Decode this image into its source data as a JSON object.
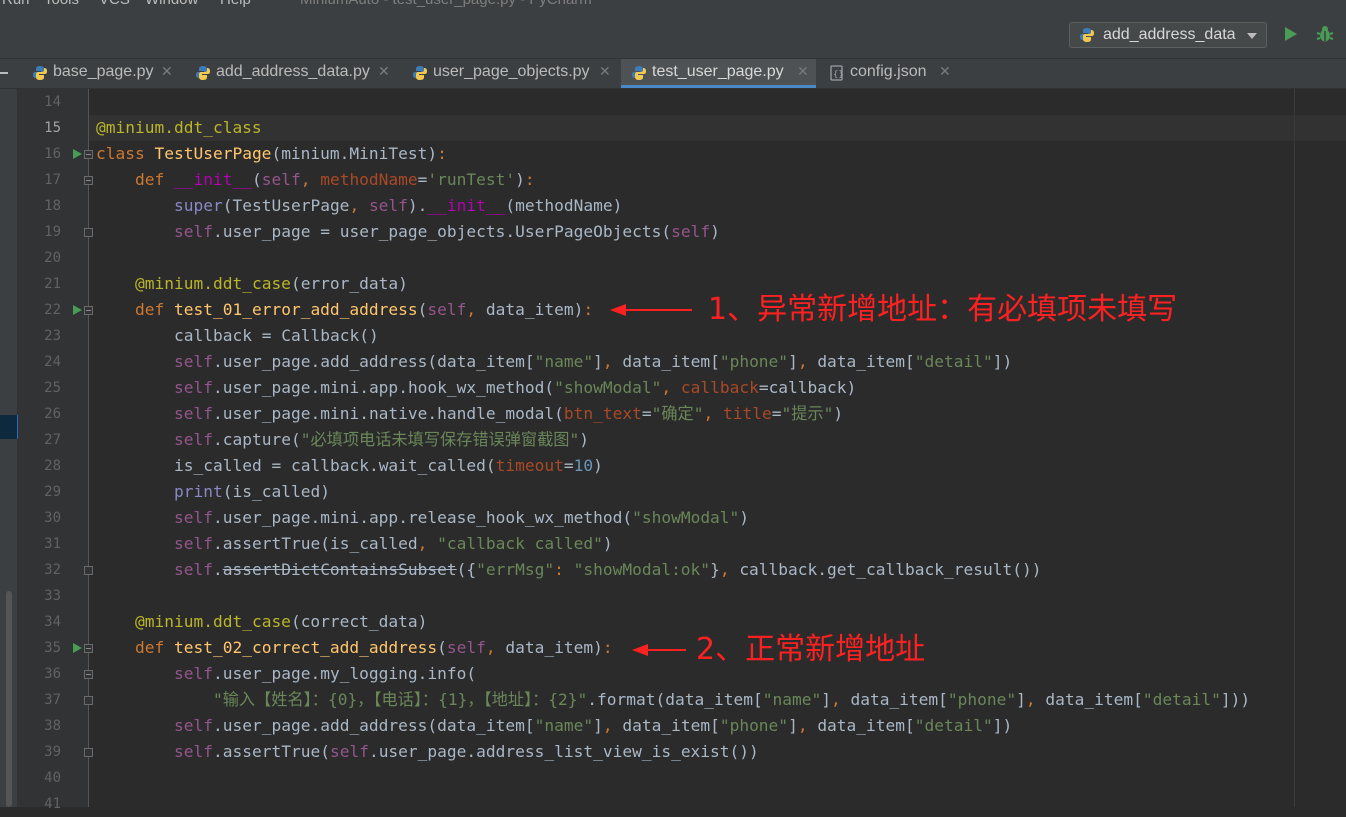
{
  "menubar": {
    "items": [
      "Run",
      "Tools",
      "VCS",
      "Window",
      "Help"
    ],
    "window_title": "MiniumAuto - test_user_page.py - PyCharm"
  },
  "toolbar": {
    "run_config_label": "add_address_data",
    "run_icon": "run-icon",
    "debug_icon": "debug-bug-icon"
  },
  "tabs": [
    {
      "label": "base_page.py",
      "icon": "python-file-icon",
      "active": false
    },
    {
      "label": "add_address_data.py",
      "icon": "python-file-icon",
      "active": false
    },
    {
      "label": "user_page_objects.py",
      "icon": "python-file-icon",
      "active": false
    },
    {
      "label": "test_user_page.py",
      "icon": "python-file-icon",
      "active": true
    },
    {
      "label": "config.json",
      "icon": "json-file-icon",
      "active": false
    }
  ],
  "editor": {
    "current_line": 15,
    "line_numbers": [
      "14",
      "15",
      "16",
      "17",
      "18",
      "19",
      "20",
      "21",
      "22",
      "23",
      "24",
      "25",
      "26",
      "27",
      "28",
      "29",
      "30",
      "31",
      "32",
      "33",
      "34",
      "35",
      "36",
      "37",
      "38",
      "39",
      "40",
      "41"
    ],
    "run_marker_lines": [
      16,
      22,
      35
    ],
    "code": [
      "",
      "@minium.ddt_class",
      "class TestUserPage(minium.MiniTest):",
      "    def __init__(self, methodName='runTest'):",
      "        super(TestUserPage, self).__init__(methodName)",
      "        self.user_page = user_page_objects.UserPageObjects(self)",
      "",
      "    @minium.ddt_case(error_data)",
      "    def test_01_error_add_address(self, data_item):",
      "        callback = Callback()",
      "        self.user_page.add_address(data_item[\"name\"], data_item[\"phone\"], data_item[\"detail\"])",
      "        self.user_page.mini.app.hook_wx_method(\"showModal\", callback=callback)",
      "        self.user_page.mini.native.handle_modal(btn_text=\"确定\", title=\"提示\")",
      "        self.capture(\"必填项电话未填写保存错误弹窗截图\")",
      "        is_called = callback.wait_called(timeout=10)",
      "        print(is_called)",
      "        self.user_page.mini.app.release_hook_wx_method(\"showModal\")",
      "        self.assertTrue(is_called, \"callback called\")",
      "        self.assertDictContainsSubset({\"errMsg\": \"showModal:ok\"}, callback.get_callback_result())",
      "",
      "    @minium.ddt_case(correct_data)",
      "    def test_02_correct_add_address(self, data_item):",
      "        self.user_page.my_logging.info(",
      "            \"输入【姓名】：{0}，【电话】：{1}，【地址】：{2}\".format(data_item[\"name\"], data_item[\"phone\"], data_item[\"detail\"]))",
      "        self.user_page.add_address(data_item[\"name\"], data_item[\"phone\"], data_item[\"detail\"])",
      "        self.assertTrue(self.user_page.address_list_view_is_exist())",
      "",
      ""
    ]
  },
  "annotations": [
    {
      "text": "1、异常新增地址：有必填项未填写",
      "color": "#ff2121"
    },
    {
      "text": "2、正常新增地址",
      "color": "#ff2121"
    }
  ]
}
